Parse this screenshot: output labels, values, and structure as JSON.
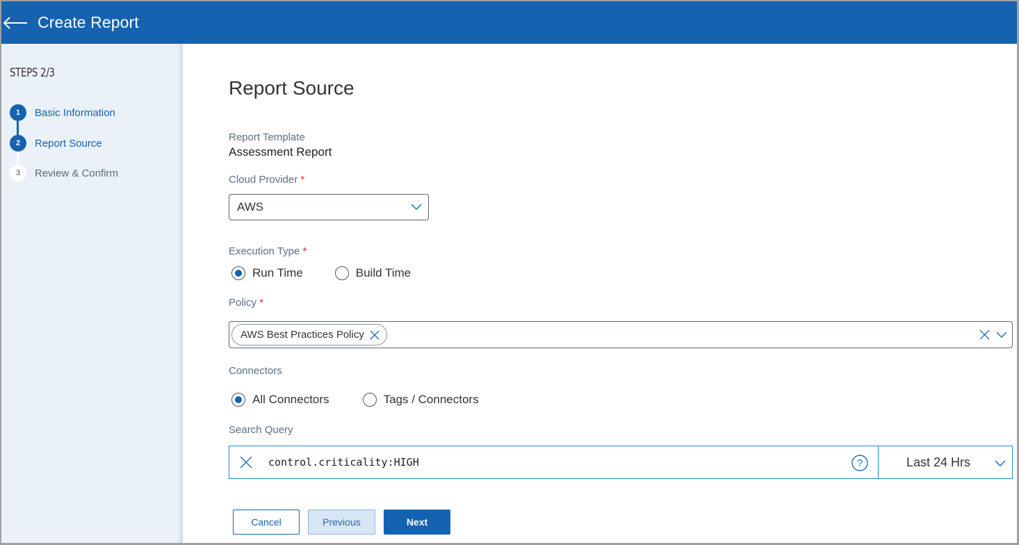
{
  "header": {
    "title": "Create Report",
    "back_icon": "arrow-left-icon"
  },
  "sidebar": {
    "steps_title": "STEPS 2/3",
    "steps": [
      {
        "number": "1",
        "label": "Basic Information",
        "state": "completed"
      },
      {
        "number": "2",
        "label": "Report Source",
        "state": "current"
      },
      {
        "number": "3",
        "label": "Review & Confirm",
        "state": "pending"
      }
    ]
  },
  "main": {
    "title": "Report Source",
    "report_template": {
      "label": "Report Template",
      "value": "Assessment Report"
    },
    "cloud_provider": {
      "label": "Cloud Provider",
      "required": "*",
      "value": "AWS"
    },
    "execution_type": {
      "label": "Execution Type",
      "required": "*",
      "options": [
        {
          "label": "Run Time",
          "selected": true
        },
        {
          "label": "Build Time",
          "selected": false
        }
      ]
    },
    "policy": {
      "label": "Policy",
      "required": "*",
      "chips": [
        "AWS Best Practices Policy"
      ]
    },
    "connectors": {
      "label": "Connectors",
      "options": [
        {
          "label": "All Connectors",
          "selected": true
        },
        {
          "label": "Tags / Connectors",
          "selected": false
        }
      ]
    },
    "search_query": {
      "label": "Search Query",
      "value": "control.criticality:HIGH",
      "time_range": "Last 24 Hrs"
    },
    "buttons": {
      "cancel": "Cancel",
      "previous": "Previous",
      "next": "Next"
    }
  },
  "colors": {
    "primary": "#1462b0",
    "required": "#d9302c",
    "focus_border": "#1d8bd0"
  }
}
